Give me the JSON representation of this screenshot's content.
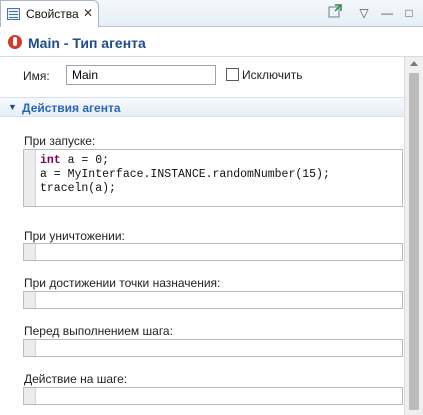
{
  "tab": {
    "label": "Свойства",
    "close": "✕"
  },
  "toolbar": {
    "pin_icon": "pin-icon",
    "view_menu": "▽",
    "minimize": "—",
    "maximize": "□"
  },
  "header": {
    "title": "Main - Тип агента"
  },
  "form": {
    "name_label": "Имя:",
    "name_value": "Main",
    "exclude_label": "Исключить",
    "exclude_checked": false
  },
  "section": {
    "title": "Действия агента",
    "expanded": true
  },
  "fields": {
    "on_startup_label": "При запуске:",
    "on_startup_code": [
      "int a = 0;",
      "a = MyInterface.INSTANCE.randomNumber(15);",
      "traceln(a);"
    ],
    "on_destroy_label": "При уничтожении:",
    "on_arrival_label": "При достижении точки назначения:",
    "before_step_label": "Перед выполнением шага:",
    "on_step_label": "Действие на шаге:"
  },
  "colors": {
    "title": "#1f4b8c",
    "section_title": "#2a66b8",
    "keyword": "#7f0055",
    "agent_icon": "#d23b30"
  }
}
